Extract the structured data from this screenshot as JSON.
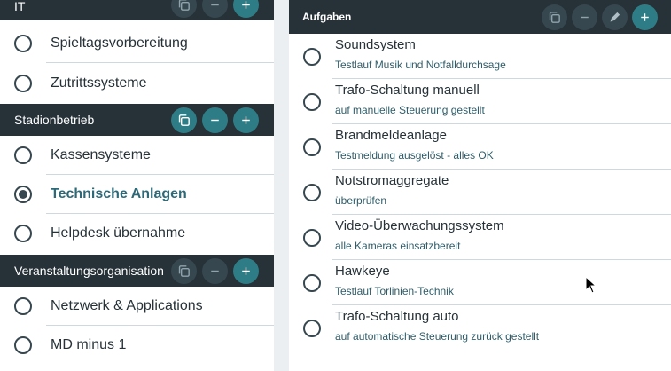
{
  "groups": [
    {
      "title": "IT",
      "items": [
        "Spieltagsvorbereitung",
        "Zutrittssysteme"
      ]
    },
    {
      "title": "Stadionbetrieb",
      "items": [
        "Kassensysteme",
        "Technische Anlagen",
        "Helpdesk übernahme"
      ],
      "selected": "Technische Anlagen"
    },
    {
      "title": "Veranstaltungsorganisation",
      "items": [
        "Netzwerk & Applications",
        "MD minus 1"
      ]
    }
  ],
  "tasks": {
    "title": "Aufgaben",
    "items": [
      {
        "title": "Soundsystem",
        "sub": "Testlauf Musik und Notfalldurchsage"
      },
      {
        "title": "Trafo-Schaltung manuell",
        "sub": "auf manuelle Steuerung gestellt"
      },
      {
        "title": "Brandmeldeanlage",
        "sub": "Testmeldung ausgelöst - alles OK"
      },
      {
        "title": "Notstromaggregate",
        "sub": "überprüfen"
      },
      {
        "title": "Video-Überwachungssystem",
        "sub": "alle Kameras einsatzbereit"
      },
      {
        "title": "Hawkeye",
        "sub": "Testlauf Torlinien-Technik"
      },
      {
        "title": "Trafo-Schaltung auto",
        "sub": "auf automatische Steuerung zurück gestellt"
      }
    ]
  },
  "colors": {
    "header_bg": "#263238",
    "accent": "#2e7d86",
    "selected_text": "#2d6a79"
  },
  "icons": [
    "copy-icon",
    "minus-icon",
    "plus-icon",
    "edit-icon",
    "mouse-cursor-icon"
  ]
}
